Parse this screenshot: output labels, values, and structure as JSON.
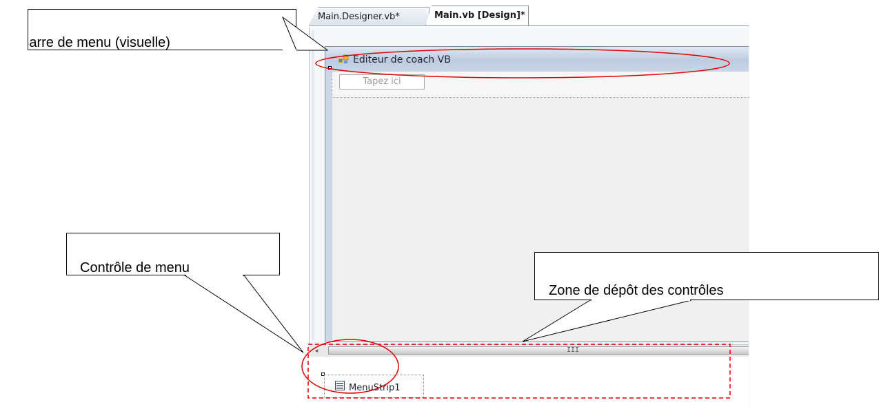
{
  "tabs": [
    {
      "label": "Main.Designer.vb*",
      "active": false
    },
    {
      "label": "Main.vb [Design]*",
      "active": true
    }
  ],
  "form": {
    "title": "Editeur de coach VB",
    "menu_placeholder": "Tapez ici"
  },
  "scrollbar": {
    "grip": "III"
  },
  "component_tray": {
    "items": [
      {
        "label": "MenuStrip1",
        "icon": "menustrip-icon"
      }
    ]
  },
  "callouts": {
    "menu_bar": "Barre de menu (visuelle)",
    "menu_control": "Contrôle de menu",
    "drop_zone": "Zone de dépôt des contrôles"
  },
  "colors": {
    "highlight": "#e00000",
    "callout_border": "#000000",
    "titlebar": "#c4d2e6"
  }
}
